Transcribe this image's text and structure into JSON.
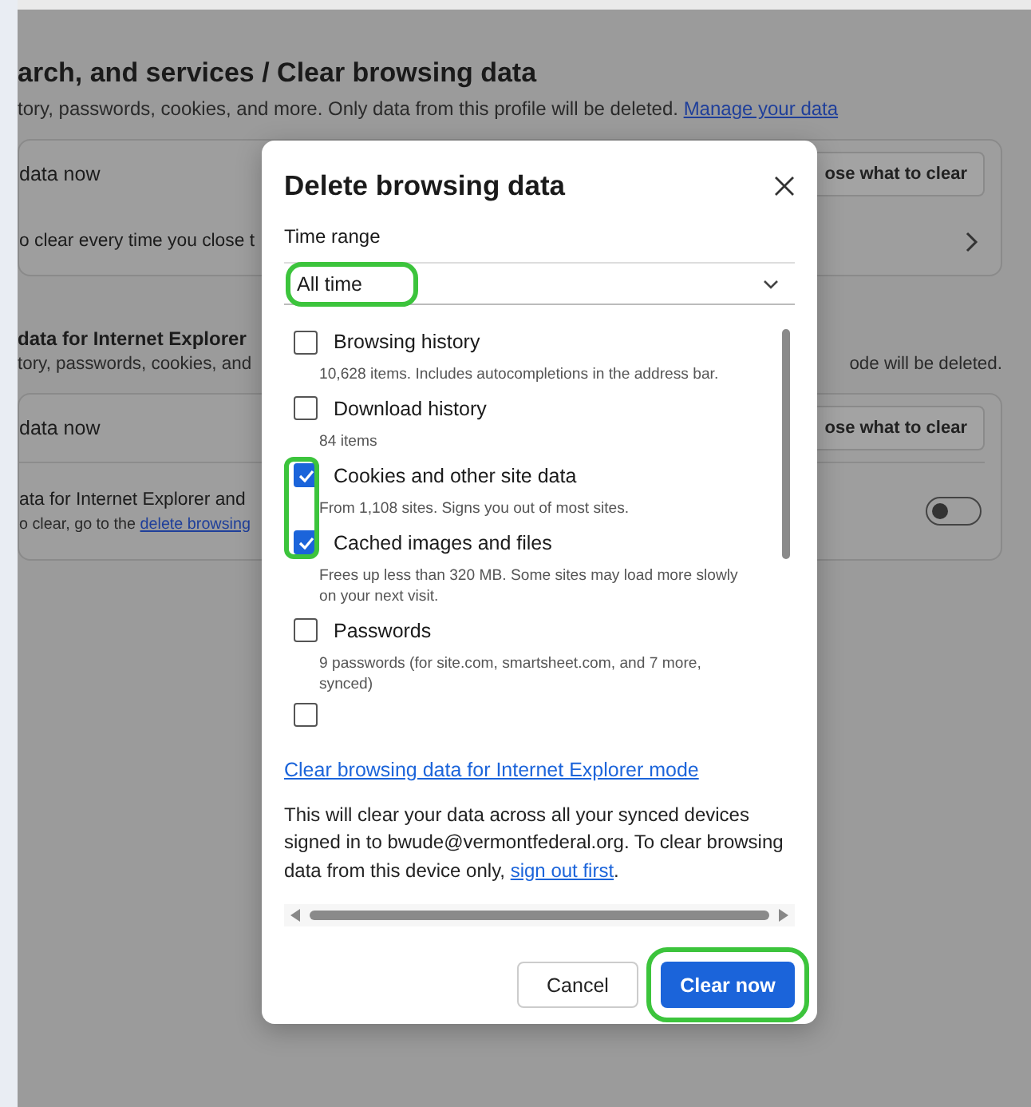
{
  "page": {
    "breadcrumb": "arch, and services / Clear browsing data",
    "description": "tory, passwords, cookies, and more. Only data from this profile will be deleted.",
    "description_link": "Manage your data",
    "card_1": [
      {
        "kind": "button",
        "label": "data now",
        "button": "ose what to clear"
      },
      {
        "kind": "chevron",
        "label": "o clear every time you close t"
      }
    ],
    "section_title": "data for Internet Explorer",
    "section_desc_left": "tory, passwords, cookies, and",
    "section_desc_right": "ode will be deleted.",
    "card_2": [
      {
        "kind": "button",
        "label": "data now",
        "button": "ose what to clear"
      },
      {
        "kind": "toggle",
        "label": "ata for Internet Explorer and",
        "sublabel": "o clear, go to the",
        "link": "delete browsing",
        "on": false
      }
    ]
  },
  "dialog": {
    "title": "Delete browsing data",
    "time_range_label": "Time range",
    "time_range": "All time",
    "items": [
      {
        "label": "Browsing history",
        "detail": "10,628 items. Includes autocompletions in the address bar.",
        "checked": false
      },
      {
        "label": "Download history",
        "detail": "84 items",
        "checked": false
      },
      {
        "label": "Cookies and other site data",
        "detail": "From 1,108 sites. Signs you out of most sites.",
        "checked": true
      },
      {
        "label": "Cached images and files",
        "detail": "Frees up less than 320 MB. Some sites may load more slowly on your next visit.",
        "checked": true
      },
      {
        "label": "Passwords",
        "detail": "9 passwords (for site.com, smartsheet.com, and 7 more, synced)",
        "checked": false
      }
    ],
    "cut_item": {
      "checked": false
    },
    "ie_link": "Clear browsing data for Internet Explorer mode",
    "notice": "This will clear your data across all your synced devices signed in to bwude@vermontfederal.org. To clear browsing data from this device only,",
    "notice_link": "sign out first",
    "notice_end": ".",
    "cancel": "Cancel",
    "confirm": "Clear now"
  }
}
